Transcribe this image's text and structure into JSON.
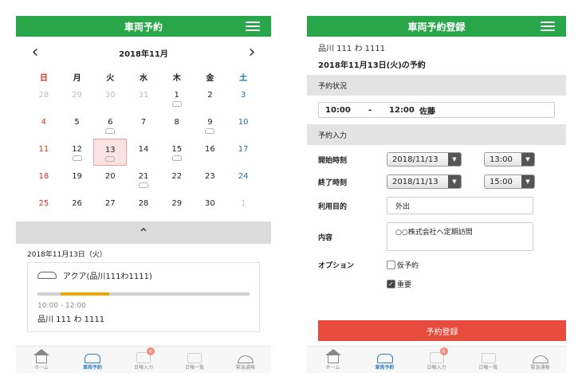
{
  "left": {
    "title": "車両予約",
    "month_label": "2018年11月",
    "weekdays": [
      "日",
      "月",
      "火",
      "水",
      "木",
      "金",
      "土"
    ],
    "weeks": [
      [
        "28",
        "29",
        "30",
        "31",
        "1",
        "2",
        "3"
      ],
      [
        "4",
        "5",
        "6",
        "7",
        "8",
        "9",
        "10"
      ],
      [
        "11",
        "12",
        "13",
        "14",
        "15",
        "16",
        "17"
      ],
      [
        "18",
        "19",
        "20",
        "21",
        "22",
        "23",
        "24"
      ],
      [
        "25",
        "26",
        "27",
        "28",
        "29",
        "30",
        "1"
      ]
    ],
    "selected_date": "13",
    "days_with_reservations": [
      "1",
      "6",
      "9",
      "12",
      "13",
      "15",
      "21"
    ],
    "reservation_date": "2018年11月13日（火）",
    "reservation": {
      "vehicle": "アクア(品川111わ1111)",
      "time": "10:00 - 12:00",
      "plate": "品川 111 わ 1111",
      "timeline_fill_start": 0.11,
      "timeline_fill_end": 0.34
    }
  },
  "right": {
    "title": "車両予約登録",
    "plate": "品川 111 わ 1111",
    "date_title": "2018年11月13日(火)の予約",
    "status_section": "予約状況",
    "status": {
      "start": "10:00",
      "sep": "-",
      "end": "12:00",
      "person": "佐藤"
    },
    "input_section": "予約入力",
    "start_label": "開始時刻",
    "start_date": "2018/11/13",
    "start_time": "13:00",
    "end_label": "終了時刻",
    "end_date": "2018/11/13",
    "end_time": "15:00",
    "purpose_label": "利用目的",
    "purpose_value": "外出",
    "content_label": "内容",
    "content_value": "○○株式会社へ定期訪問",
    "option_label": "オプション",
    "option_provisional": "仮予約",
    "option_important": "重要",
    "option_important_checked": true,
    "submit_label": "予約登録"
  },
  "nav": [
    {
      "label": "ホーム",
      "icon": "home-icon"
    },
    {
      "label": "車両予約",
      "icon": "car-icon",
      "active": true
    },
    {
      "label": "日報入力",
      "icon": "report-icon",
      "badge": "6"
    },
    {
      "label": "日報一覧",
      "icon": "report-list-icon"
    },
    {
      "label": "緊急通報",
      "icon": "emergency-bell-icon"
    }
  ],
  "colors": {
    "header": "#2aa64a",
    "accent": "#2d7ec4",
    "submit": "#e84c3d",
    "timeline": "#f0a500",
    "sunday": "#d9331a",
    "saturday": "#1a73b8"
  }
}
